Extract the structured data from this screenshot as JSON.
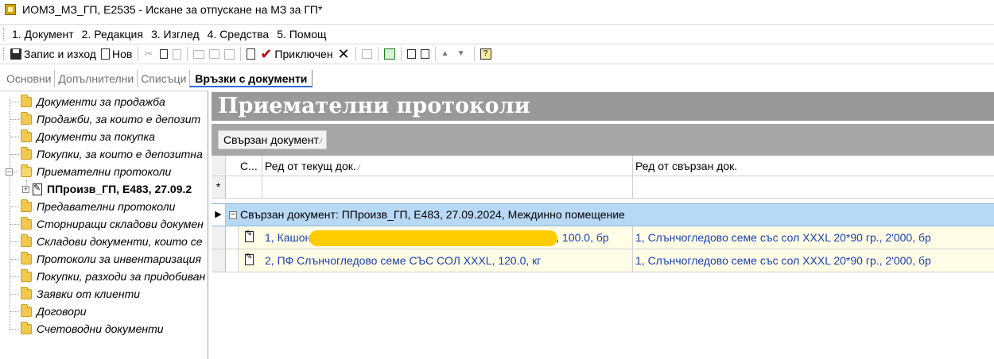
{
  "window": {
    "title": "ИОМЗ_МЗ_ГП, Е2535 - Искане за отпускане на МЗ за ГП*"
  },
  "menu": {
    "items": [
      {
        "label": "1. Документ"
      },
      {
        "label": "2. Редакция"
      },
      {
        "label": "3. Изглед"
      },
      {
        "label": "4. Средства"
      },
      {
        "label": "5. Помощ"
      }
    ]
  },
  "toolbar": {
    "save_label": "Запис и изход",
    "new_label": "Нов",
    "complete_label": "Приключен"
  },
  "tabs": [
    {
      "label": "Основни",
      "active": false
    },
    {
      "label": "Допълнителни",
      "active": false
    },
    {
      "label": "Списъци",
      "active": false
    },
    {
      "label": "Връзки с документи",
      "active": true
    }
  ],
  "tree": {
    "items": [
      {
        "label": "Документи за продажба"
      },
      {
        "label": "Продажби, за които е депозит"
      },
      {
        "label": "Документи за покупка"
      },
      {
        "label": "Покупки, за които е депозитна"
      },
      {
        "label": "Приемателни протоколи",
        "expanded": true
      },
      {
        "label": "ППроизв_ГП, Е483, 27.09.2",
        "child": true,
        "selected": true
      },
      {
        "label": "Предавателни протоколи"
      },
      {
        "label": "Сторниращи складови докумен"
      },
      {
        "label": "Складови документи, които се"
      },
      {
        "label": "Протоколи за инвентаризация"
      },
      {
        "label": "Покупки, разходи за придобиван"
      },
      {
        "label": "Заявки от клиенти"
      },
      {
        "label": "Договори"
      },
      {
        "label": "Счетоводни документи"
      }
    ]
  },
  "panel": {
    "title": "Приемателни протоколи",
    "group_by_chip": "Свързан документ",
    "columns": {
      "c": "С...",
      "current_row": "Ред от текущ док.",
      "linked_row": "Ред от свързан док."
    },
    "new_row_marker": "*",
    "group_row": "Свързан документ: ППроизв_ГП, Е483, 27.09.2024, Междинно помещение",
    "rows": [
      {
        "current_prefix": "1, Кашон",
        "current_suffix": ", 100.0, бр",
        "linked": "1, Слънчогледово семе със сол XXXL 20*90 гр., 2'000, бр"
      },
      {
        "current_full": "2, ПФ Слънчогледово семе СЪС СОЛ  XXXL, 120.0, кг",
        "linked": "1, Слънчогледово семе със сол XXXL 20*90 гр., 2'000, бр"
      }
    ]
  }
}
